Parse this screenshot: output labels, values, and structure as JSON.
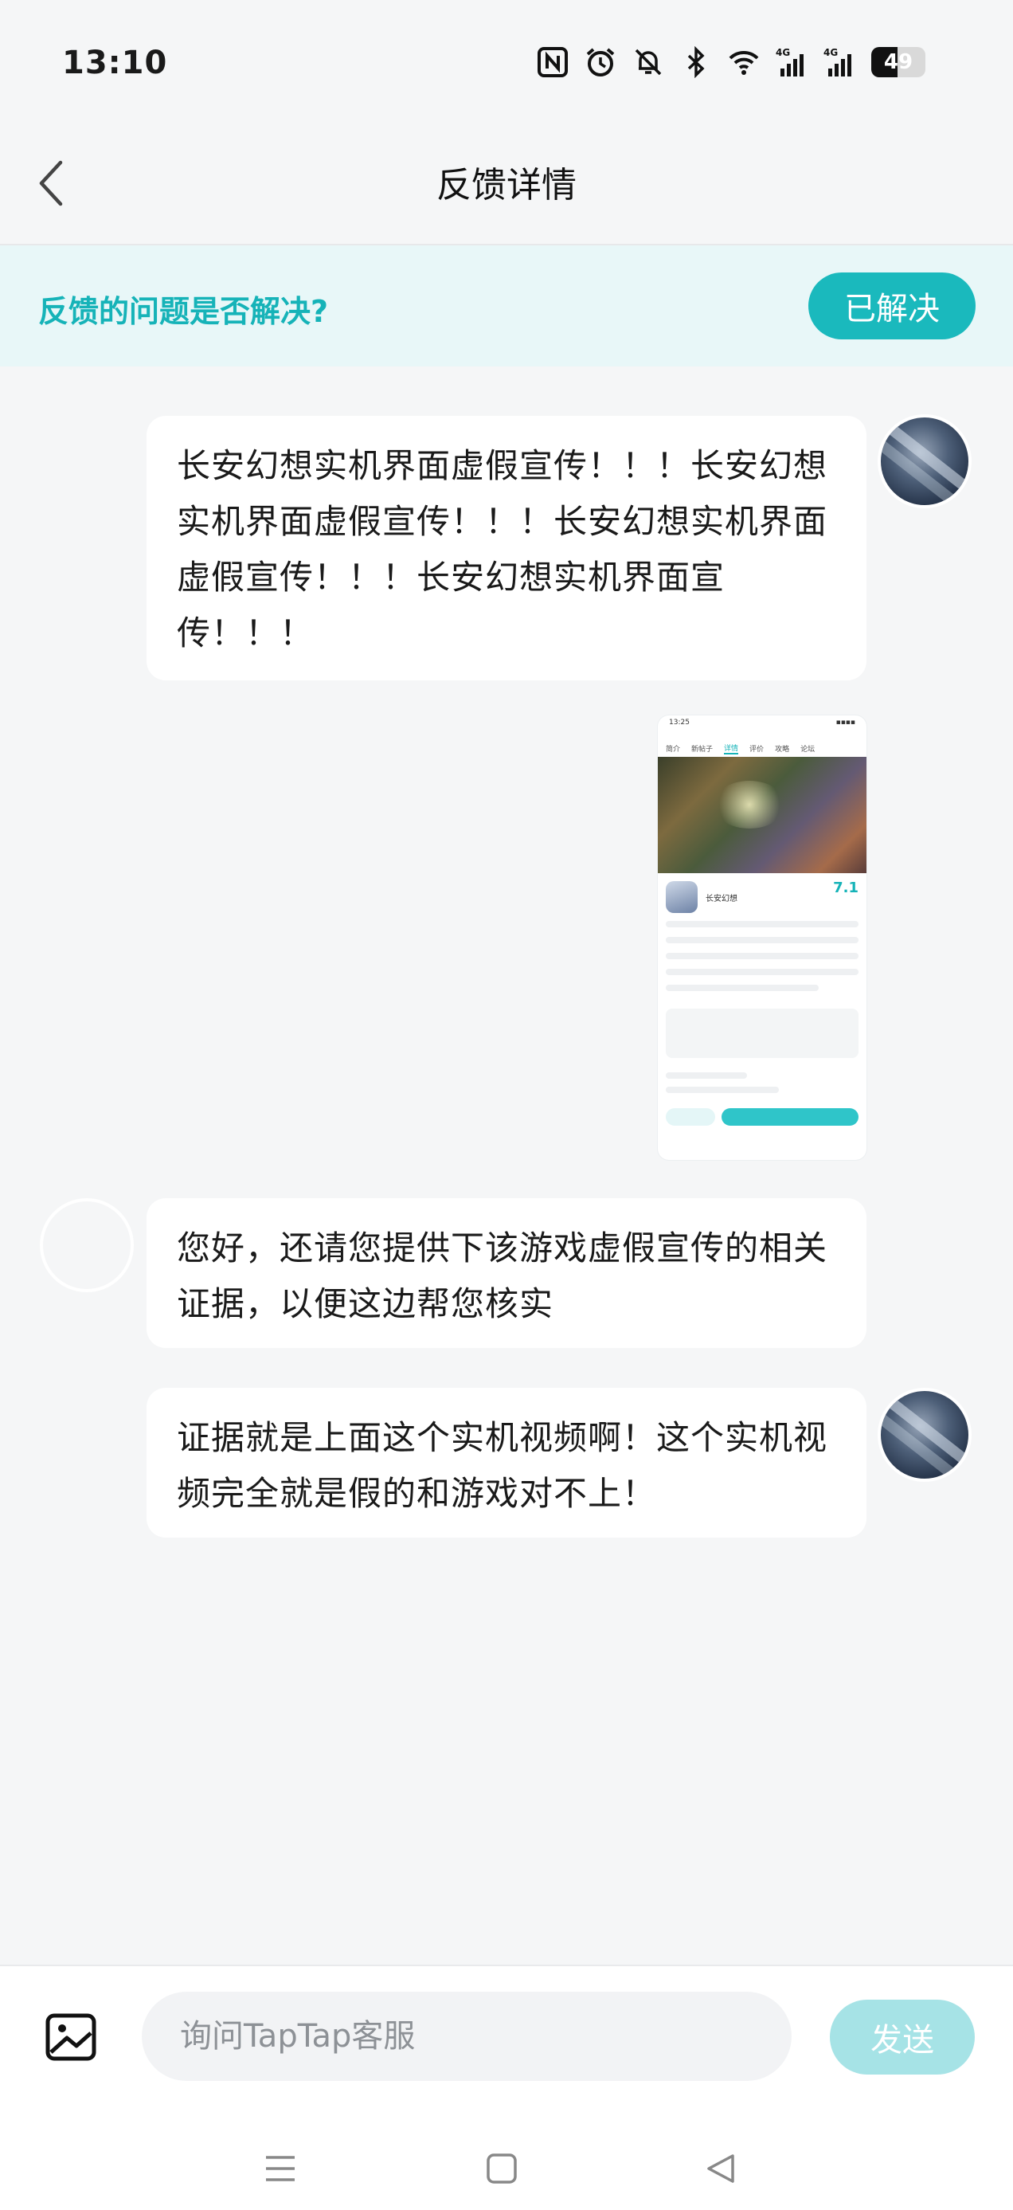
{
  "status_bar": {
    "time": "13:10",
    "battery_level": "49",
    "icons": [
      "nfc-icon",
      "alarm-icon",
      "mute-icon",
      "bluetooth-icon",
      "wifi-icon",
      "signal-4g-icon",
      "signal-4g-icon",
      "battery-icon"
    ]
  },
  "header": {
    "title": "反馈详情",
    "back_icon": "chevron-left-icon"
  },
  "banner": {
    "question": "反馈的问题是否解决?",
    "resolved_label": "已解决"
  },
  "messages": [
    {
      "sender": "user",
      "text": "长安幻想实机界面虚假宣传！！！长安幻想实机界面虚假宣传！！！长安幻想实机界面虚假宣传！！！长安幻想实机界面宣传！！！"
    },
    {
      "sender": "user",
      "type": "image",
      "thumb": {
        "status_time": "13:25",
        "tabs": [
          "简介",
          "新帖子",
          "详情",
          "评价",
          "攻略",
          "论坛"
        ],
        "game_name": "长安幻想",
        "score": "7.1"
      }
    },
    {
      "sender": "support",
      "text": "您好，还请您提供下该游戏虚假宣传的相关证据，以便这边帮您核实"
    },
    {
      "sender": "user",
      "text": "证据就是上面这个实机视频啊！这个实机视频完全就是假的和游戏对不上！"
    }
  ],
  "input_bar": {
    "placeholder": "询问TapTap客服",
    "send_label": "发送",
    "image_icon": "image-icon"
  },
  "nav": [
    "menu-icon",
    "home-square-icon",
    "back-triangle-icon"
  ],
  "colors": {
    "accent": "#1ab9bd",
    "banner_bg": "#e8f7f8",
    "send_disabled": "#a6e3e6",
    "page_bg": "#f5f6f7"
  }
}
